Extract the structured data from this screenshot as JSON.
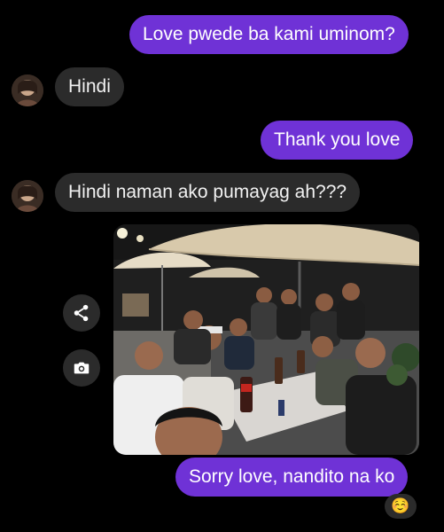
{
  "messages": [
    {
      "side": "sent",
      "text": "Love pwede ba kami uminom?"
    },
    {
      "side": "received",
      "text": "Hindi"
    },
    {
      "side": "sent",
      "text": "Thank you love"
    },
    {
      "side": "received",
      "text": "Hindi naman ako pumayag ah???"
    },
    {
      "side": "sent",
      "type": "photo",
      "description_icon": "group-photo"
    },
    {
      "side": "sent",
      "text": "Sorry love, nandito na ko"
    }
  ],
  "actions": {
    "share_icon": "share-icon",
    "camera_icon": "camera-icon"
  },
  "reaction": {
    "emoji": "☺️"
  },
  "colors": {
    "background": "#000000",
    "sent_bubble": "#6f32d6",
    "received_bubble": "#2b2b2b",
    "text_light": "#ffffff"
  }
}
